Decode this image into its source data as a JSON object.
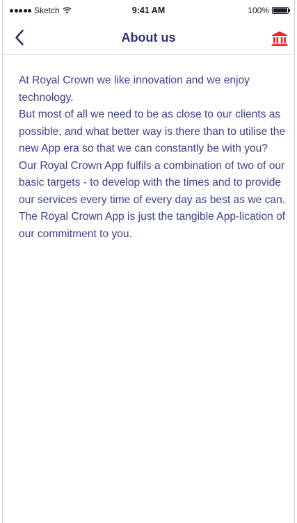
{
  "status_bar": {
    "carrier": "Sketch",
    "time": "9:41 AM",
    "battery": "100%",
    "icons": [
      "signal-dots-icon",
      "wifi-icon",
      "battery-icon"
    ]
  },
  "nav": {
    "title": "About us",
    "back_icon": "chevron-left-icon",
    "action_icon": "bank-building-icon"
  },
  "colors": {
    "text": "#3b3f8c",
    "title": "#2e3170",
    "accent": "#e8262b"
  },
  "body": {
    "paragraphs": [
      "At Royal Crown we like innovation and we enjoy technology.",
      "But most of all we need to be as close to our clients as possible, and what better way is there than to utilise the new App era so that we can constantly be with you?",
      "Our Royal Crown App fulfils a combination of two of our basic targets - to develop with the times and to provide our services every time of every day as best as we can.",
      "The Royal Crown App is just the tangible App-lication of our commitment to you."
    ]
  }
}
